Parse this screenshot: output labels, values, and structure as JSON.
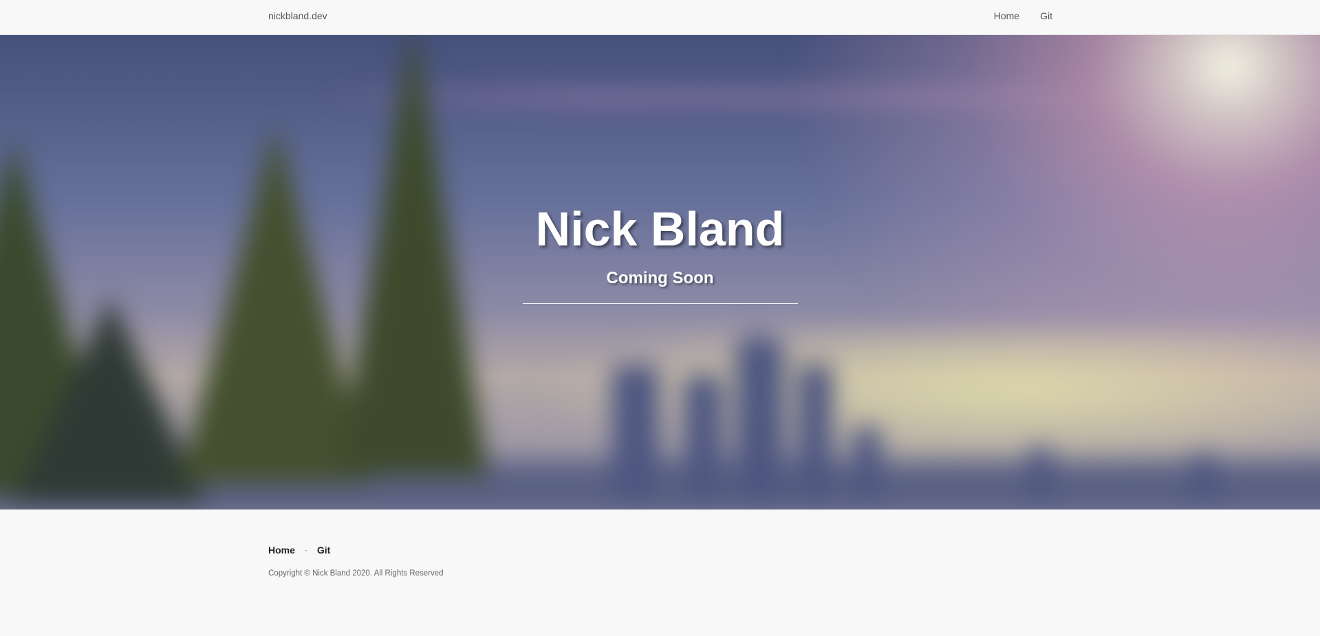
{
  "navbar": {
    "brand": "nickbland.dev",
    "links": [
      {
        "label": "Home"
      },
      {
        "label": "Git"
      }
    ]
  },
  "hero": {
    "title": "Nick Bland",
    "subtitle": "Coming Soon",
    "background": "blurred city skyline with pine trees and sun"
  },
  "footer": {
    "links": [
      {
        "label": "Home"
      },
      {
        "label": "Git"
      }
    ],
    "separator": "·",
    "copyright": "Copyright © Nick Bland 2020. All Rights Reserved"
  }
}
